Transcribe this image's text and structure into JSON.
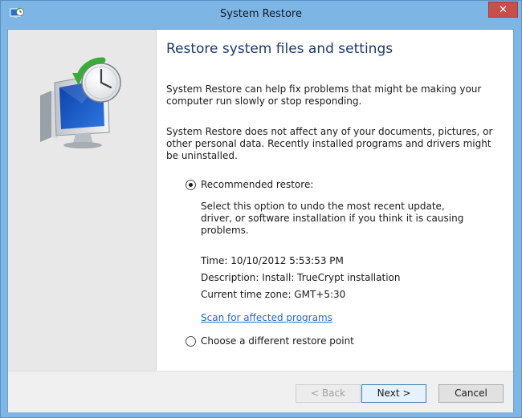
{
  "window": {
    "title": "System Restore",
    "close_label": "✕"
  },
  "icons": {
    "app": "system-restore-icon",
    "hero": "system-restore-clock-monitor-icon"
  },
  "main": {
    "heading": "Restore system files and settings",
    "paragraph1": "System Restore can help fix problems that might be making your computer run slowly or stop responding.",
    "paragraph2": "System Restore does not affect any of your documents, pictures, or other personal data. Recently installed programs and drivers might be uninstalled.",
    "options": [
      {
        "label": "Recommended restore:",
        "selected": true,
        "description": "Select this option to undo the most recent update, driver, or software installation if you think it is causing problems."
      },
      {
        "label": "Choose a different restore point",
        "selected": false
      }
    ],
    "details": {
      "time": "Time: 10/10/2012 5:53:53 PM",
      "description": "Description: Install: TrueCrypt installation",
      "timezone": "Current time zone: GMT+5:30"
    },
    "scan_link": "Scan for affected programs"
  },
  "footer": {
    "back_label": "< Back",
    "next_label": "Next >",
    "cancel_label": "Cancel"
  },
  "colors": {
    "titlebar": "#7db5e5",
    "heading": "#1c3a6b",
    "link": "#1d6ad0",
    "close": "#c7504b"
  }
}
